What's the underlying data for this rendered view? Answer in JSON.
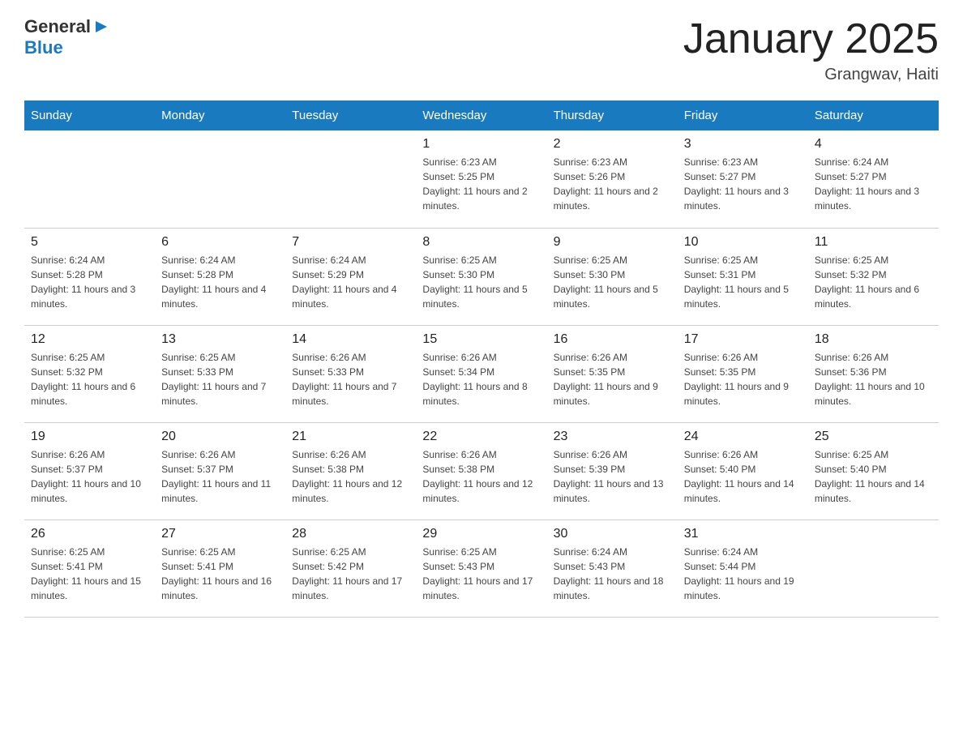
{
  "logo": {
    "general": "General",
    "blue": "Blue",
    "arrow": "▶"
  },
  "title": "January 2025",
  "location": "Grangwav, Haiti",
  "days_of_week": [
    "Sunday",
    "Monday",
    "Tuesday",
    "Wednesday",
    "Thursday",
    "Friday",
    "Saturday"
  ],
  "weeks": [
    [
      {
        "day": "",
        "info": ""
      },
      {
        "day": "",
        "info": ""
      },
      {
        "day": "",
        "info": ""
      },
      {
        "day": "1",
        "info": "Sunrise: 6:23 AM\nSunset: 5:25 PM\nDaylight: 11 hours and 2 minutes."
      },
      {
        "day": "2",
        "info": "Sunrise: 6:23 AM\nSunset: 5:26 PM\nDaylight: 11 hours and 2 minutes."
      },
      {
        "day": "3",
        "info": "Sunrise: 6:23 AM\nSunset: 5:27 PM\nDaylight: 11 hours and 3 minutes."
      },
      {
        "day": "4",
        "info": "Sunrise: 6:24 AM\nSunset: 5:27 PM\nDaylight: 11 hours and 3 minutes."
      }
    ],
    [
      {
        "day": "5",
        "info": "Sunrise: 6:24 AM\nSunset: 5:28 PM\nDaylight: 11 hours and 3 minutes."
      },
      {
        "day": "6",
        "info": "Sunrise: 6:24 AM\nSunset: 5:28 PM\nDaylight: 11 hours and 4 minutes."
      },
      {
        "day": "7",
        "info": "Sunrise: 6:24 AM\nSunset: 5:29 PM\nDaylight: 11 hours and 4 minutes."
      },
      {
        "day": "8",
        "info": "Sunrise: 6:25 AM\nSunset: 5:30 PM\nDaylight: 11 hours and 5 minutes."
      },
      {
        "day": "9",
        "info": "Sunrise: 6:25 AM\nSunset: 5:30 PM\nDaylight: 11 hours and 5 minutes."
      },
      {
        "day": "10",
        "info": "Sunrise: 6:25 AM\nSunset: 5:31 PM\nDaylight: 11 hours and 5 minutes."
      },
      {
        "day": "11",
        "info": "Sunrise: 6:25 AM\nSunset: 5:32 PM\nDaylight: 11 hours and 6 minutes."
      }
    ],
    [
      {
        "day": "12",
        "info": "Sunrise: 6:25 AM\nSunset: 5:32 PM\nDaylight: 11 hours and 6 minutes."
      },
      {
        "day": "13",
        "info": "Sunrise: 6:25 AM\nSunset: 5:33 PM\nDaylight: 11 hours and 7 minutes."
      },
      {
        "day": "14",
        "info": "Sunrise: 6:26 AM\nSunset: 5:33 PM\nDaylight: 11 hours and 7 minutes."
      },
      {
        "day": "15",
        "info": "Sunrise: 6:26 AM\nSunset: 5:34 PM\nDaylight: 11 hours and 8 minutes."
      },
      {
        "day": "16",
        "info": "Sunrise: 6:26 AM\nSunset: 5:35 PM\nDaylight: 11 hours and 9 minutes."
      },
      {
        "day": "17",
        "info": "Sunrise: 6:26 AM\nSunset: 5:35 PM\nDaylight: 11 hours and 9 minutes."
      },
      {
        "day": "18",
        "info": "Sunrise: 6:26 AM\nSunset: 5:36 PM\nDaylight: 11 hours and 10 minutes."
      }
    ],
    [
      {
        "day": "19",
        "info": "Sunrise: 6:26 AM\nSunset: 5:37 PM\nDaylight: 11 hours and 10 minutes."
      },
      {
        "day": "20",
        "info": "Sunrise: 6:26 AM\nSunset: 5:37 PM\nDaylight: 11 hours and 11 minutes."
      },
      {
        "day": "21",
        "info": "Sunrise: 6:26 AM\nSunset: 5:38 PM\nDaylight: 11 hours and 12 minutes."
      },
      {
        "day": "22",
        "info": "Sunrise: 6:26 AM\nSunset: 5:38 PM\nDaylight: 11 hours and 12 minutes."
      },
      {
        "day": "23",
        "info": "Sunrise: 6:26 AM\nSunset: 5:39 PM\nDaylight: 11 hours and 13 minutes."
      },
      {
        "day": "24",
        "info": "Sunrise: 6:26 AM\nSunset: 5:40 PM\nDaylight: 11 hours and 14 minutes."
      },
      {
        "day": "25",
        "info": "Sunrise: 6:25 AM\nSunset: 5:40 PM\nDaylight: 11 hours and 14 minutes."
      }
    ],
    [
      {
        "day": "26",
        "info": "Sunrise: 6:25 AM\nSunset: 5:41 PM\nDaylight: 11 hours and 15 minutes."
      },
      {
        "day": "27",
        "info": "Sunrise: 6:25 AM\nSunset: 5:41 PM\nDaylight: 11 hours and 16 minutes."
      },
      {
        "day": "28",
        "info": "Sunrise: 6:25 AM\nSunset: 5:42 PM\nDaylight: 11 hours and 17 minutes."
      },
      {
        "day": "29",
        "info": "Sunrise: 6:25 AM\nSunset: 5:43 PM\nDaylight: 11 hours and 17 minutes."
      },
      {
        "day": "30",
        "info": "Sunrise: 6:24 AM\nSunset: 5:43 PM\nDaylight: 11 hours and 18 minutes."
      },
      {
        "day": "31",
        "info": "Sunrise: 6:24 AM\nSunset: 5:44 PM\nDaylight: 11 hours and 19 minutes."
      },
      {
        "day": "",
        "info": ""
      }
    ]
  ]
}
